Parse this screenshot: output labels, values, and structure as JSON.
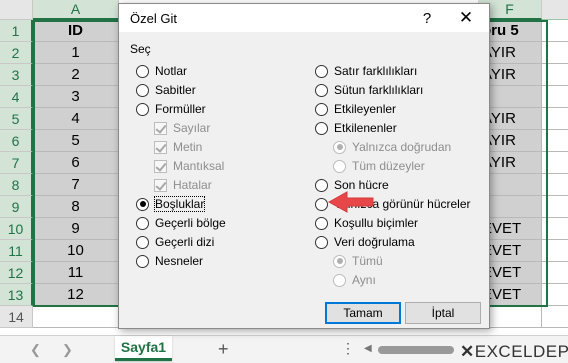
{
  "sheet": {
    "columns": [
      {
        "label": "A",
        "selected": true
      },
      {
        "label": "F",
        "selected": true
      }
    ],
    "rows": [
      {
        "num": "1",
        "a": "ID",
        "f": "oru 5"
      },
      {
        "num": "2",
        "a": "1",
        "f": "AYIR"
      },
      {
        "num": "3",
        "a": "2",
        "f": "AYIR"
      },
      {
        "num": "4",
        "a": "3",
        "f": ""
      },
      {
        "num": "5",
        "a": "4",
        "f": "AYIR"
      },
      {
        "num": "6",
        "a": "5",
        "f": "AYIR"
      },
      {
        "num": "7",
        "a": "6",
        "f": "AYIR"
      },
      {
        "num": "8",
        "a": "7",
        "f": ""
      },
      {
        "num": "9",
        "a": "8",
        "f": ""
      },
      {
        "num": "10",
        "a": "9",
        "f": "EVET"
      },
      {
        "num": "11",
        "a": "10",
        "f": "EVET"
      },
      {
        "num": "12",
        "a": "11",
        "f": "EVET"
      },
      {
        "num": "13",
        "a": "12",
        "f": "EVET"
      },
      {
        "num": "14",
        "a": "",
        "f": ""
      }
    ],
    "tab_name": "Sayfa1",
    "add_sheet_icon": "+",
    "more_icon": "⋮",
    "nav_prev_icon": "❮",
    "nav_next_icon": "❯",
    "scroll_left_icon": "◀"
  },
  "branding": {
    "logo_part1": "EXCEL",
    "logo_part2": "DEPO"
  },
  "dialog": {
    "title": "Özel Git",
    "help_icon": "?",
    "close_icon": "✕",
    "group_label": "Seç",
    "left_options": [
      {
        "label": "Notlar",
        "type": "radio",
        "checked": false,
        "disabled": false
      },
      {
        "label": "Sabitler",
        "type": "radio",
        "checked": false,
        "disabled": false
      },
      {
        "label": "Formüller",
        "type": "radio",
        "checked": false,
        "disabled": false
      },
      {
        "label": "Sayılar",
        "type": "check",
        "checked": true,
        "disabled": true
      },
      {
        "label": "Metin",
        "type": "check",
        "checked": true,
        "disabled": true
      },
      {
        "label": "Mantıksal",
        "type": "check",
        "checked": true,
        "disabled": true
      },
      {
        "label": "Hatalar",
        "type": "check",
        "checked": true,
        "disabled": true
      },
      {
        "label": "Boşluklar",
        "type": "radio",
        "checked": true,
        "disabled": false
      },
      {
        "label": "Geçerli bölge",
        "type": "radio",
        "checked": false,
        "disabled": false
      },
      {
        "label": "Geçerli dizi",
        "type": "radio",
        "checked": false,
        "disabled": false
      },
      {
        "label": "Nesneler",
        "type": "radio",
        "checked": false,
        "disabled": false
      }
    ],
    "right_options": [
      {
        "label": "Satır farklılıkları",
        "type": "radio",
        "checked": false,
        "disabled": false
      },
      {
        "label": "Sütun farklılıkları",
        "type": "radio",
        "checked": false,
        "disabled": false
      },
      {
        "label": "Etkileyenler",
        "type": "radio",
        "checked": false,
        "disabled": false
      },
      {
        "label": "Etkilenenler",
        "type": "radio",
        "checked": false,
        "disabled": false
      },
      {
        "label": "Yalnızca doğrudan",
        "type": "radio",
        "checked": true,
        "disabled": true
      },
      {
        "label": "Tüm düzeyler",
        "type": "radio",
        "checked": false,
        "disabled": true
      },
      {
        "label": "Son hücre",
        "type": "radio",
        "checked": false,
        "disabled": false
      },
      {
        "label": "Yalnızca görünür hücreler",
        "type": "radio",
        "checked": false,
        "disabled": false
      },
      {
        "label": "Koşullu biçimler",
        "type": "radio",
        "checked": false,
        "disabled": false
      },
      {
        "label": "Veri doğrulama",
        "type": "radio",
        "checked": false,
        "disabled": false
      },
      {
        "label": "Tümü",
        "type": "radio",
        "checked": true,
        "disabled": true
      },
      {
        "label": "Aynı",
        "type": "radio",
        "checked": false,
        "disabled": true
      }
    ],
    "ok_label": "Tamam",
    "cancel_label": "İptal"
  },
  "colors": {
    "accent": "#217346",
    "arrow": "#e8474a",
    "selection_fill": "#d0d0d0"
  }
}
